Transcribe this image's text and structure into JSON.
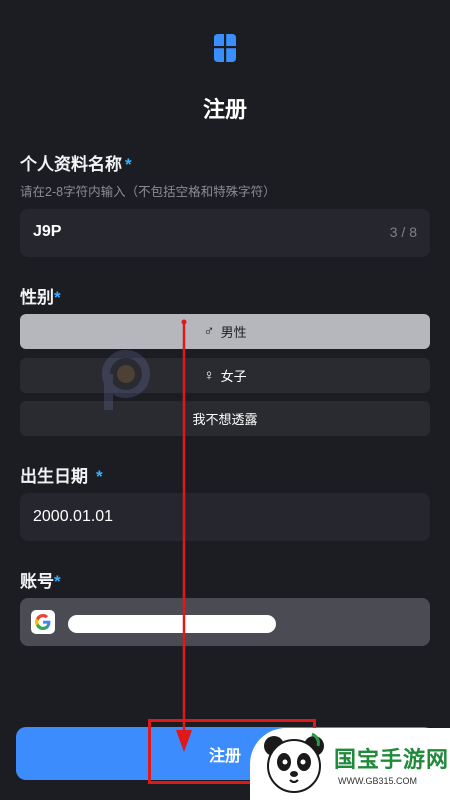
{
  "app": {
    "logo_icon": "app-logo-icon",
    "title": "注册"
  },
  "profile_name": {
    "label": "个人资料名称",
    "required_mark": "*",
    "hint": "请在2-8字符内输入（不包括空格和特殊字符）",
    "value": "J9P",
    "char_count": "3 / 8"
  },
  "gender": {
    "label": "性别",
    "required_mark": "*",
    "options": [
      {
        "symbol": "♂",
        "label": "男性",
        "selected": true
      },
      {
        "symbol": "♀",
        "label": "女子",
        "selected": false
      },
      {
        "symbol": "",
        "label": "我不想透露",
        "selected": false
      }
    ]
  },
  "birthdate": {
    "label": "出生日期",
    "required_mark": "*",
    "value": "2000.01.01"
  },
  "account": {
    "label": "账号",
    "required_mark": "*",
    "provider_icon": "google-icon"
  },
  "submit": {
    "label": "注册"
  },
  "watermark": {
    "site_name": "国宝手游网",
    "url": "WWW.GB315.COM"
  },
  "colors": {
    "background": "#1c1d22",
    "field": "#26272e",
    "accent": "#3ab0ff",
    "button": "#3c8cfd",
    "annotation": "#e01818"
  }
}
